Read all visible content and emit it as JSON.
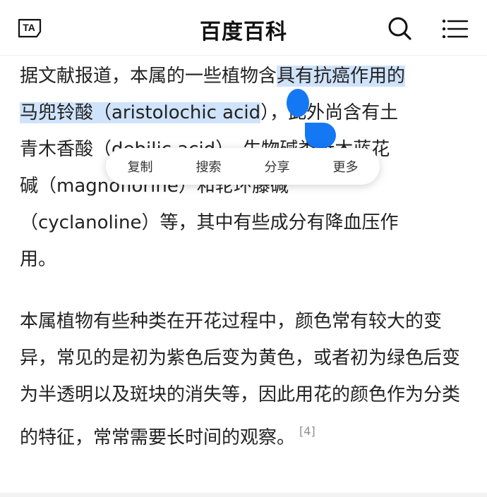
{
  "header": {
    "title": "百度百科",
    "font_icon_label": "TA",
    "search_icon": "search-icon",
    "menu_icon": "menu-icon"
  },
  "article": {
    "paragraph1": {
      "lines": [
        {
          "plain": "据文献报道，本属的一些植物含",
          "selected": "具有抗癌作用的"
        },
        {
          "selected": "马兜铃酸（aristolochic acid",
          "plain": "），此外尚含有土"
        },
        {
          "plain": "青木香酸（debilic acid）、生物碱类析木蓝花"
        },
        {
          "plain": "碱（magnoflorine）和轮环藤碱"
        },
        {
          "plain": "（cyclanoline）等，其中有些成分有降血压作"
        },
        {
          "plain": "用。"
        }
      ]
    },
    "paragraph2": {
      "text": "本属植物有些种类在开花过程中，颜色常有较大的变异，常见的是初为紫色后变为黄色，或者初为绿色后变为半透明以及斑块的消失等，因此用花的颜色作为分类的特征，常常需要长时间的观察。",
      "reference": "[4]"
    }
  },
  "selection_menu": {
    "copy": "复制",
    "search": "搜索",
    "share": "分享",
    "more": "更多"
  },
  "colors": {
    "selection_highlight": "#cfe3fb",
    "handle_blue": "#1478f5",
    "text": "#222222",
    "reference": "#8f8f8f"
  }
}
